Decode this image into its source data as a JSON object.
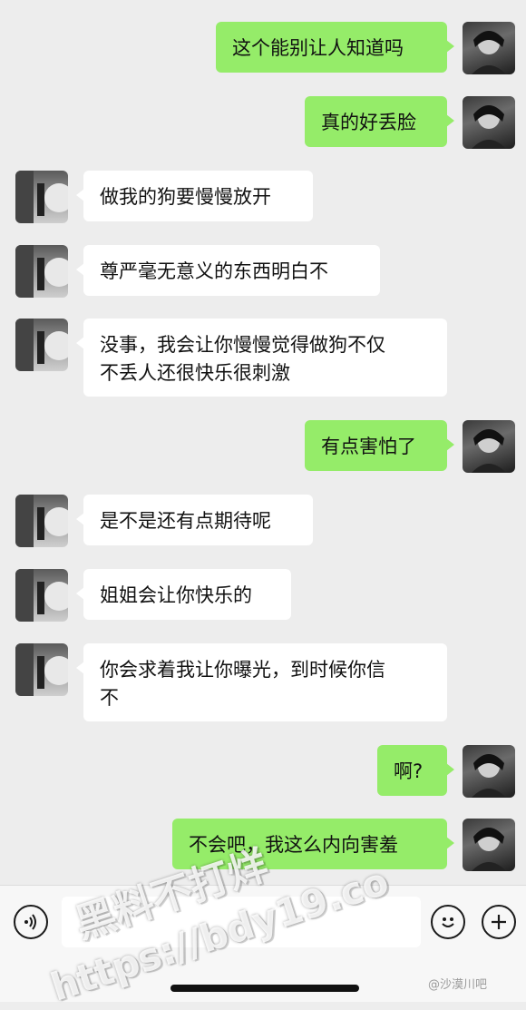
{
  "messages": [
    {
      "from": "me",
      "text": "这个能别让人知道吗"
    },
    {
      "from": "me",
      "text": "真的好丢脸"
    },
    {
      "from": "her",
      "text": "做我的狗要慢慢放开"
    },
    {
      "from": "her",
      "text": "尊严毫无意义的东西明白不"
    },
    {
      "from": "her",
      "line1": "没事，我会让你慢慢觉得做狗不仅",
      "line2": "不丢人还很快乐很刺激"
    },
    {
      "from": "me",
      "text": "有点害怕了"
    },
    {
      "from": "her",
      "text": "是不是还有点期待呢"
    },
    {
      "from": "her",
      "text": "姐姐会让你快乐的"
    },
    {
      "from": "her",
      "line1": "你会求着我让你曝光，到时候你信",
      "line2": "不"
    },
    {
      "from": "me",
      "text": "啊?"
    },
    {
      "from": "me",
      "text": "不会吧，我这么内向害羞"
    }
  ],
  "input_bar": {
    "voice_icon": "voice-icon",
    "emoji_icon": "emoji-icon",
    "plus_icon": "plus-icon",
    "input_value": ""
  },
  "watermarks": {
    "line1": "黑料不打烊",
    "line2": "https://bdy19.co",
    "corner": "@沙漠川吧"
  },
  "colors": {
    "background": "#ededed",
    "my_bubble": "#95ec69",
    "her_bubble": "#ffffff"
  }
}
